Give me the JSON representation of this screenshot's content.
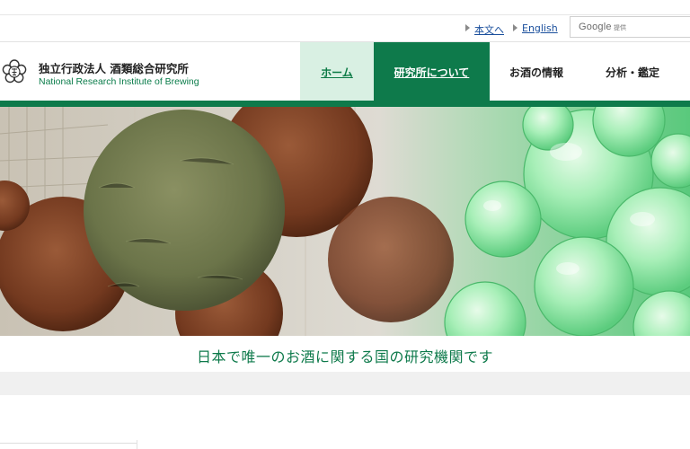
{
  "utility": {
    "main_text_link": "本文へ",
    "english_link": "English"
  },
  "search": {
    "logo_text": "Google",
    "provided_text": "提供"
  },
  "header": {
    "org_name_ja": "独立行政法人 酒類総合研究所",
    "org_name_en": "National Research Institute of Brewing"
  },
  "nav": {
    "items": [
      {
        "label": "ホーム"
      },
      {
        "label": "研究所について"
      },
      {
        "label": "お酒の情報"
      },
      {
        "label": "分析・鑑定"
      }
    ]
  },
  "hero": {
    "tagline": "日本で唯一のお酒に関する国の研究機関です"
  },
  "colors": {
    "brand_green": "#0e7a4b",
    "home_tab_bg": "#d9f0e3",
    "link_blue": "#1a4f9c"
  }
}
